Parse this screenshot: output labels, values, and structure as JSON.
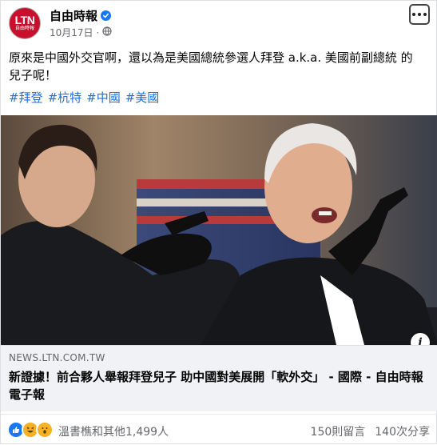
{
  "page": {
    "name": "自由時報",
    "logo_text": "LTN",
    "logo_sub": "自由時報",
    "date": "10月17日",
    "privacy_icon": "globe-icon",
    "menu_icon": "more-dots-icon"
  },
  "post": {
    "text": "原來是中國外交官啊，還以為是美國總統參選人拜登 a.k.a. 美國前副總統 的兒子呢！",
    "hashtags": [
      "#拜登",
      "#杭特",
      "#中國",
      "#美國"
    ]
  },
  "link": {
    "domain": "NEWS.LTN.COM.TW",
    "title": "新證據！前合夥人舉報拜登兒子 助中國對美展開「軟外交」 - 國際 - 自由時報電子報"
  },
  "footer": {
    "reaction_icons": [
      "like-icon",
      "haha-icon",
      "wow-icon"
    ],
    "reactions_text": "溫書樵和其他1,499人",
    "comments": "150則留言",
    "shares": "140次分享"
  },
  "colors": {
    "accent": "#1877f2",
    "hashtag": "#216fdb",
    "brand_red": "#c8102e"
  }
}
